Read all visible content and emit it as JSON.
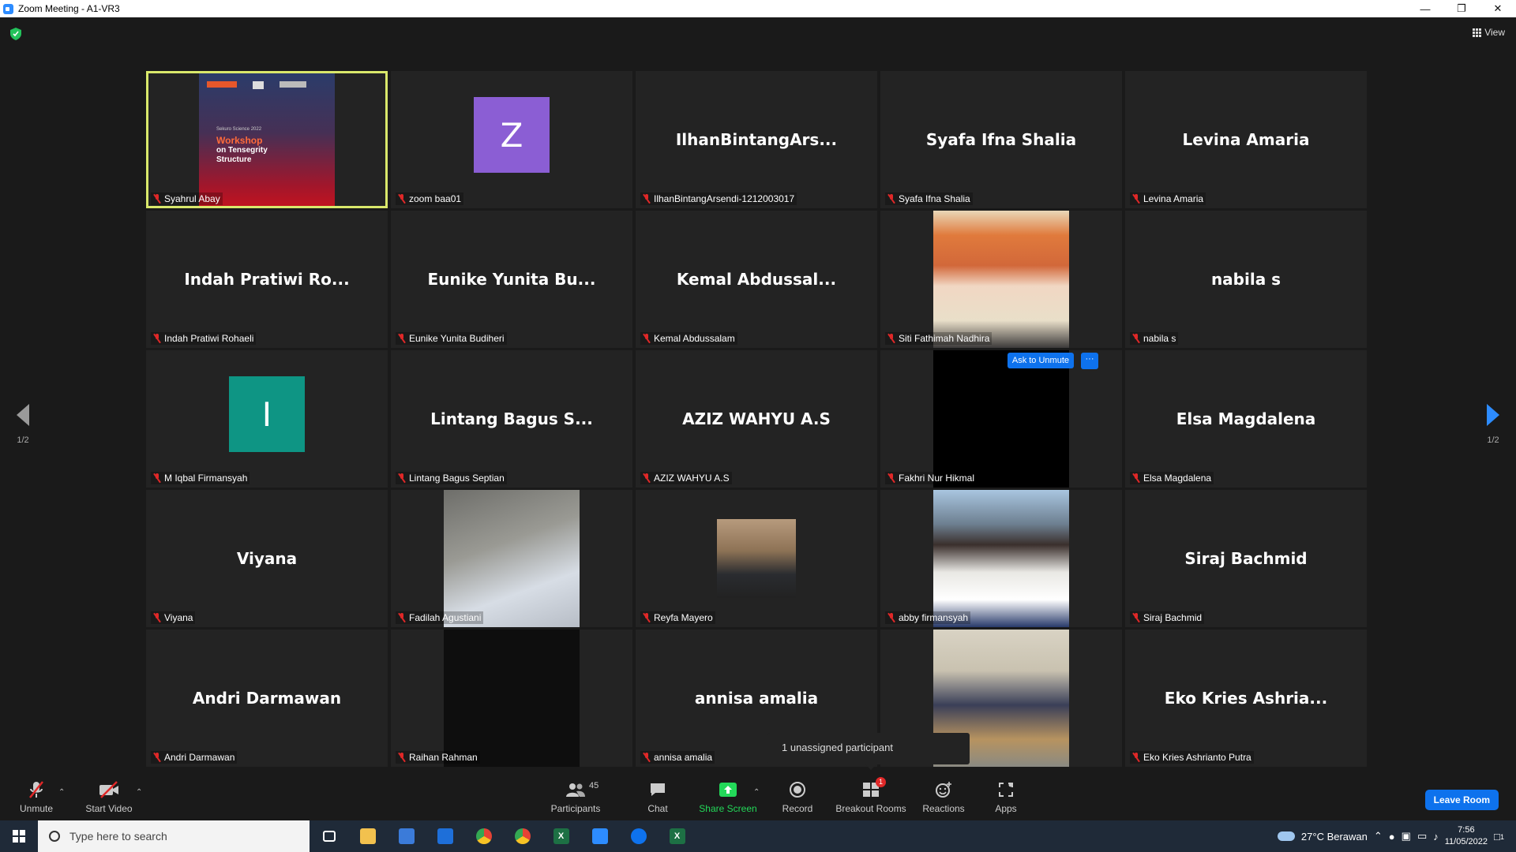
{
  "window": {
    "title": "Zoom Meeting - A1-VR3"
  },
  "header": {
    "view_label": "View"
  },
  "pagination": {
    "left": "1/2",
    "right": "1/2"
  },
  "tiles": [
    {
      "name": "Syahrul Abay",
      "kind": "screen",
      "share_lines": [
        "Sekuro Science 2022",
        "Workshop",
        "on Tensegrity",
        "Structure"
      ],
      "active": true
    },
    {
      "name": "zoom baa01",
      "kind": "letter",
      "letter": "Z",
      "color": "#8b5ed4"
    },
    {
      "name": "IlhanBintangArsendi-1212003017",
      "kind": "text",
      "display": "IlhanBintangArs..."
    },
    {
      "name": "Syafa Ifna Shalia",
      "kind": "text",
      "display": "Syafa Ifna Shalia"
    },
    {
      "name": "Levina Amaria",
      "kind": "text",
      "display": "Levina Amaria"
    },
    {
      "name": "Indah Pratiwi Rohaeli",
      "kind": "text",
      "display": "Indah Pratiwi Ro..."
    },
    {
      "name": "Eunike Yunita Budiheri",
      "kind": "text",
      "display": "Eunike Yunita Bu..."
    },
    {
      "name": "Kemal Abdussalam",
      "kind": "text",
      "display": "Kemal Abdussal..."
    },
    {
      "name": "Siti Fathimah Nadhira",
      "kind": "photo",
      "photo": "anime"
    },
    {
      "name": "nabila s",
      "kind": "text",
      "display": "nabila s"
    },
    {
      "name": "M Iqbal Firmansyah",
      "kind": "letter",
      "letter": "I",
      "color": "#0e9584"
    },
    {
      "name": "Lintang Bagus Septian",
      "kind": "text",
      "display": "Lintang Bagus S..."
    },
    {
      "name": "AZIZ WAHYU A.S",
      "kind": "text",
      "display": "AZIZ WAHYU A.S"
    },
    {
      "name": "Fakhri Nur Hikmal",
      "kind": "photo",
      "photo": "black",
      "hover": true
    },
    {
      "name": "Elsa Magdalena",
      "kind": "text",
      "display": "Elsa Magdalena"
    },
    {
      "name": "Viyana",
      "kind": "text",
      "display": "Viyana"
    },
    {
      "name": "Fadilah Agustiani",
      "kind": "photo",
      "photo": "floor"
    },
    {
      "name": "Reyfa Mayero",
      "kind": "photo",
      "photo": "small-person"
    },
    {
      "name": "abby firmansyah",
      "kind": "photo",
      "photo": "sweater"
    },
    {
      "name": "Siraj Bachmid",
      "kind": "text",
      "display": "Siraj Bachmid"
    },
    {
      "name": "Andri Darmawan",
      "kind": "text",
      "display": "Andri Darmawan"
    },
    {
      "name": "Raihan Rahman",
      "kind": "photo",
      "photo": "dark"
    },
    {
      "name": "annisa amalia",
      "kind": "text",
      "display": "annisa amalia"
    },
    {
      "name": "",
      "kind": "photo",
      "photo": "sitting",
      "no_label": true
    },
    {
      "name": "Eko Kries Ashrianto Putra",
      "kind": "text",
      "display": "Eko Kries Ashria..."
    }
  ],
  "hover_actions": {
    "ask_unmute": "Ask to Unmute",
    "more": "···"
  },
  "tooltip": "1 unassigned participant",
  "toolbar": {
    "unmute": "Unmute",
    "start_video": "Start Video",
    "participants": "Participants",
    "participant_count": "45",
    "chat": "Chat",
    "share_screen": "Share Screen",
    "record": "Record",
    "breakout_rooms": "Breakout Rooms",
    "breakout_badge": "1",
    "reactions": "Reactions",
    "apps": "Apps",
    "leave": "Leave Room"
  },
  "taskbar": {
    "search_placeholder": "Type here to search",
    "weather": "27°C  Berawan",
    "time": "7:56",
    "date": "11/05/2022",
    "notification_count": "1"
  },
  "colors": {
    "accent": "#0e72ed",
    "active_speaker": "#d9e86b",
    "muted": "#e02828",
    "share_green": "#23d959"
  }
}
